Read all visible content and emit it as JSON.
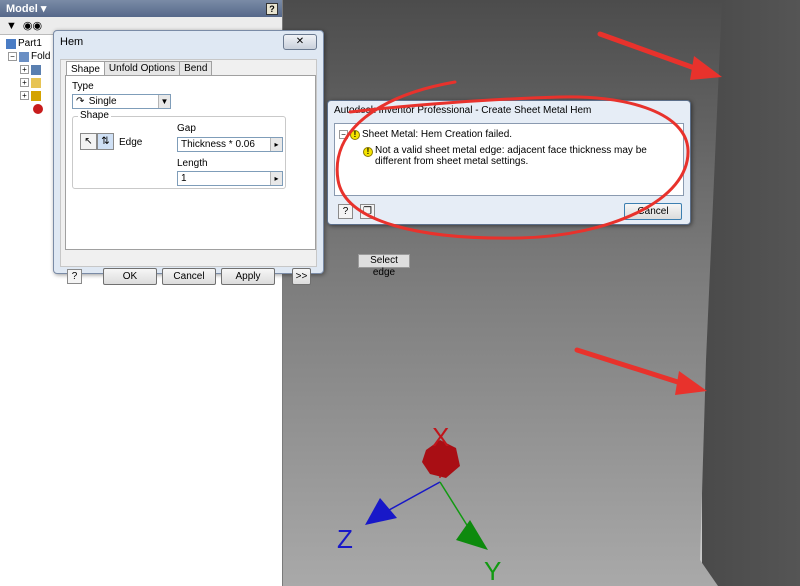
{
  "model_panel": {
    "title": "Model ▾",
    "help_icon": "?",
    "filter_icon": "funnel-icon",
    "search_icon": "binoculars-icon",
    "tree": {
      "root": "Part1",
      "folder_label": "Fold"
    }
  },
  "hem_dialog": {
    "title": "Hem",
    "close_label": "✕",
    "tabs": [
      "Shape",
      "Unfold Options",
      "Bend"
    ],
    "type_label": "Type",
    "type_value": "Single",
    "shape_group": "Shape",
    "edge_label": "Edge",
    "gap_label": "Gap",
    "gap_value": "Thickness * 0.06",
    "length_label": "Length",
    "length_value": "1",
    "buttons": {
      "ok": "OK",
      "cancel": "Cancel",
      "apply": "Apply",
      "more": ">>"
    }
  },
  "error_dialog": {
    "title": "Autodesk Inventor Professional - Create Sheet Metal Hem",
    "message_main": "Sheet Metal: Hem Creation failed.",
    "message_detail": "Not a valid sheet metal edge: adjacent face thickness may be different from sheet metal settings.",
    "cancel_label": "Cancel"
  },
  "tooltip": "Select edge",
  "axes": {
    "x": "X",
    "y": "Y",
    "z": "Z"
  },
  "colors": {
    "annotation": "#e8322c",
    "x_axis": "#c0141a",
    "y_axis": "#119a11",
    "z_axis": "#1818c8"
  }
}
